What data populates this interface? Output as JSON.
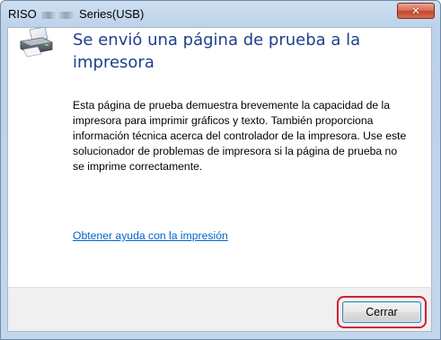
{
  "window": {
    "title_prefix": "RISO",
    "title_suffix": "Series(USB)",
    "close_symbol": "✕"
  },
  "icon": {
    "name": "printer-icon"
  },
  "heading": "Se envió una página de prueba a la impresora",
  "body": "Esta página de prueba demuestra brevemente la capacidad de la impresora para imprimir gráficos y texto. También proporciona información técnica acerca del controlador de la impresora.  Use este solucionador de problemas de impresora si la página de prueba no se imprime correctamente.",
  "help_link": "Obtener ayuda con la impresión",
  "buttons": {
    "close_label": "Cerrar"
  },
  "colors": {
    "heading": "#1e3f8c",
    "link": "#0066cc",
    "highlight": "#d21f2e",
    "close_button": "#c8452c"
  }
}
